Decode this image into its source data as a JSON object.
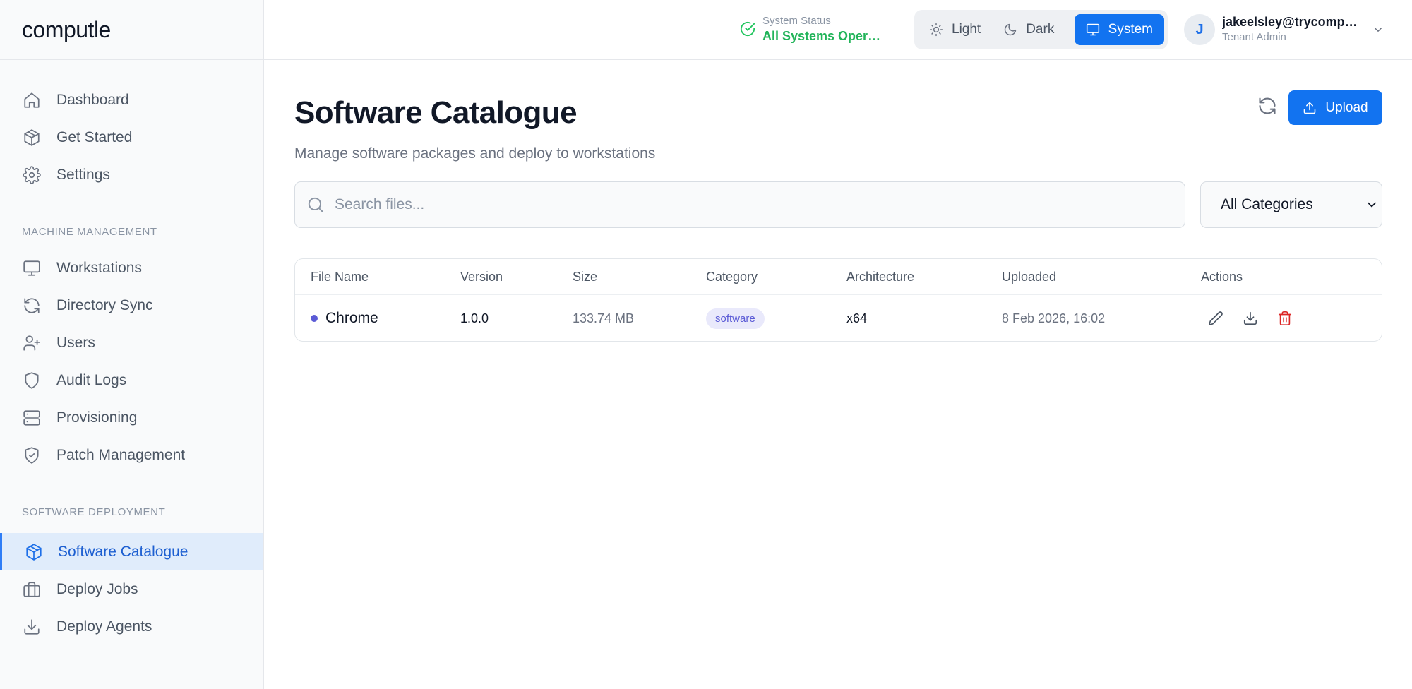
{
  "app": {
    "brand": "computle"
  },
  "sidebar": {
    "top_items": [
      {
        "label": "Dashboard",
        "icon": "home-icon"
      },
      {
        "label": "Get Started",
        "icon": "package-icon"
      },
      {
        "label": "Settings",
        "icon": "gear-icon"
      }
    ],
    "sections": [
      {
        "title": "MACHINE MANAGEMENT",
        "items": [
          {
            "label": "Workstations",
            "icon": "monitor-icon"
          },
          {
            "label": "Directory Sync",
            "icon": "sync-icon"
          },
          {
            "label": "Users",
            "icon": "user-plus-icon"
          },
          {
            "label": "Audit Logs",
            "icon": "shield-icon"
          },
          {
            "label": "Provisioning",
            "icon": "server-icon"
          },
          {
            "label": "Patch Management",
            "icon": "shield-check-icon"
          }
        ]
      },
      {
        "title": "SOFTWARE DEPLOYMENT",
        "items": [
          {
            "label": "Software Catalogue",
            "icon": "package-icon",
            "active": true
          },
          {
            "label": "Deploy Jobs",
            "icon": "briefcase-icon"
          },
          {
            "label": "Deploy Agents",
            "icon": "download-icon"
          }
        ]
      }
    ]
  },
  "header": {
    "status_label": "System Status",
    "status_value": "All Systems Operational",
    "theme": {
      "light": "Light",
      "dark": "Dark",
      "system": "System",
      "selected": "System"
    },
    "user": {
      "initial": "J",
      "email": "jakeelsley@trycomputle.com",
      "role": "Tenant Admin"
    }
  },
  "main": {
    "title": "Software Catalogue",
    "subtitle": "Manage software packages and deploy to workstations",
    "upload_label": "Upload",
    "search_placeholder": "Search files...",
    "category_filter": "All Categories",
    "table": {
      "columns": [
        "File Name",
        "Version",
        "Size",
        "Category",
        "Architecture",
        "Uploaded",
        "Actions"
      ],
      "rows": [
        {
          "name": "Chrome",
          "version": "1.0.0",
          "size": "133.74 MB",
          "category": "software",
          "architecture": "x64",
          "uploaded": "8 Feb 2026, 16:02"
        }
      ]
    }
  },
  "colors": {
    "accent": "#1273f0",
    "status_ok": "#22b45a",
    "category_badge": "#5b5bd6",
    "danger": "#dc2626"
  }
}
